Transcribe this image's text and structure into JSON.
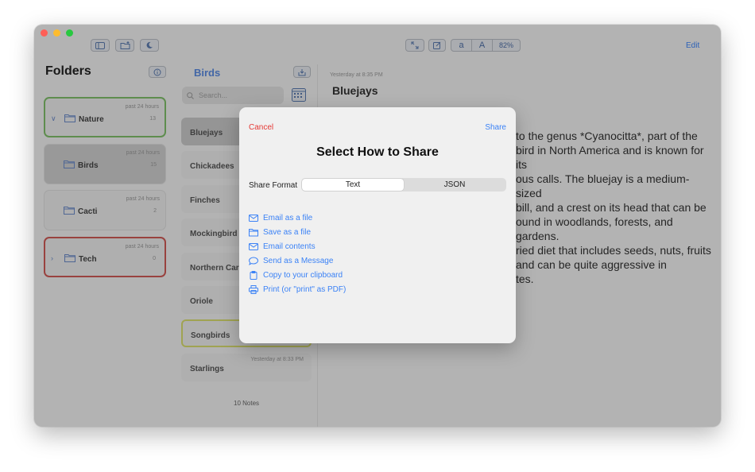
{
  "toolbar": {
    "zoom_small": "a",
    "zoom_large": "A",
    "zoom_level": "82%",
    "edit": "Edit"
  },
  "sidebar": {
    "title": "Folders",
    "folders": [
      {
        "name": "Nature",
        "timestamp": "past 24 hours",
        "count": "13"
      },
      {
        "name": "Birds",
        "timestamp": "past 24 hours",
        "count": "15"
      },
      {
        "name": "Cacti",
        "timestamp": "past 24 hours",
        "count": "2"
      },
      {
        "name": "Tech",
        "timestamp": "past 24 hours",
        "count": "0"
      }
    ]
  },
  "notes": {
    "title": "Birds",
    "search_placeholder": "Search...",
    "items": [
      {
        "title": "Bluejays"
      },
      {
        "title": "Chickadees"
      },
      {
        "title": "Finches"
      },
      {
        "title": "Mockingbird"
      },
      {
        "title": "Northern Cardinal"
      },
      {
        "title": "Oriole"
      },
      {
        "title": "Songbirds"
      },
      {
        "title": "Starlings",
        "timestamp": "Yesterday at 8:33 PM"
      }
    ],
    "count": "10 Notes"
  },
  "detail": {
    "timestamp": "Yesterday at 8:35 PM",
    "title": "Bluejays",
    "lines": [
      "to the genus *Cyanocitta*, part of the",
      "bird in North America and is known for its",
      "ous calls. The bluejay is a medium-sized",
      "bill, and a crest on its head that can be",
      "ound in woodlands, forests, and gardens.",
      "ried diet that includes seeds, nuts, fruits",
      "and can be quite aggressive in",
      "tes."
    ]
  },
  "share_dialog": {
    "cancel": "Cancel",
    "share": "Share",
    "title": "Select How to Share",
    "format_label": "Share Format",
    "formats": [
      "Text",
      "JSON"
    ],
    "selected_format": "Text",
    "options": [
      {
        "label": "Email as a file",
        "icon": "envelope-icon"
      },
      {
        "label": "Save as a file",
        "icon": "folder-icon"
      },
      {
        "label": "Email contents",
        "icon": "envelope-icon"
      },
      {
        "label": "Send as a Message",
        "icon": "message-bubble-icon"
      },
      {
        "label": "Copy to your clipboard",
        "icon": "clipboard-icon"
      },
      {
        "label": "Print (or \"print\" as PDF)",
        "icon": "printer-icon"
      }
    ]
  },
  "colors": {
    "accent": "#3b82f6",
    "destructive": "#e53935",
    "nature_border": "#7fbf6a",
    "tech_border": "#cf5a55",
    "songbirds_border": "#d8dc6f"
  }
}
